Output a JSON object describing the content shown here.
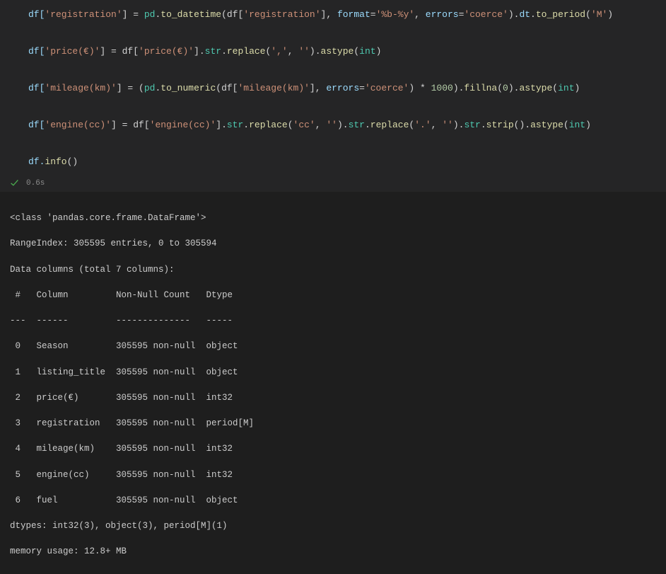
{
  "code": {
    "line1": {
      "a": "df[",
      "s1": "'registration'",
      "b": "] = ",
      "pd": "pd",
      "c": ".",
      "todt": "to_datetime",
      "d": "(df[",
      "s2": "'registration'",
      "e": "], ",
      "fmtk": "format",
      "f": "=",
      "s3": "'%b-%y'",
      "g": ", ",
      "errk": "errors",
      "h": "=",
      "s4": "'coerce'",
      "i": ").",
      "dt": "dt",
      "j": ".",
      "tp": "to_period",
      "k": "(",
      "s5": "'M'",
      "l": ")"
    },
    "line2": {
      "a": "df[",
      "s1": "'price(€)'",
      "b": "] = df[",
      "s2": "'price(€)'",
      "c": "].",
      "strm": "str",
      "d": ".",
      "rep": "replace",
      "e": "(",
      "s3": "','",
      "f": ", ",
      "s4": "''",
      "g": ").",
      "ast": "astype",
      "h": "(",
      "inttype": "int",
      "i": ")"
    },
    "line3": {
      "a": "df[",
      "s1": "'mileage(km)'",
      "b": "] = (",
      "pd": "pd",
      "c": ".",
      "ton": "to_numeric",
      "d": "(df[",
      "s2": "'mileage(km)'",
      "e": "], ",
      "errk": "errors",
      "f": "=",
      "s3": "'coerce'",
      "g": ") * ",
      "thou": "1000",
      "h": ").",
      "fillna": "fillna",
      "i": "(",
      "zero": "0",
      "j": ").",
      "ast": "astype",
      "k": "(",
      "inttype": "int",
      "l": ")"
    },
    "line4": {
      "a": "df[",
      "s1": "'engine(cc)'",
      "b": "] = df[",
      "s2": "'engine(cc)'",
      "c": "].",
      "strm": "str",
      "d": ".",
      "rep": "replace",
      "e": "(",
      "s3": "'cc'",
      "f": ", ",
      "s4": "''",
      "g": ").",
      "strm2": "str",
      "h": ".",
      "rep2": "replace",
      "i": "(",
      "s5": "'.'",
      "j": ", ",
      "s6": "''",
      "k": ").",
      "strm3": "str",
      "l": ".",
      "strip": "strip",
      "m": "().",
      "ast": "astype",
      "n": "(",
      "inttype": "int",
      "o": ")"
    },
    "line5": {
      "a": "df.",
      "info": "info",
      "b": "()"
    }
  },
  "status": {
    "time": "0.6s"
  },
  "output": {
    "l1": "<class 'pandas.core.frame.DataFrame'>",
    "l2": "RangeIndex: 305595 entries, 0 to 305594",
    "l3": "Data columns (total 7 columns):",
    "l4": " #   Column         Non-Null Count   Dtype    ",
    "l5": "---  ------         --------------   -----    ",
    "l6": " 0   Season         305595 non-null  object   ",
    "l7": " 1   listing_title  305595 non-null  object   ",
    "l8": " 2   price(€)       305595 non-null  int32    ",
    "l9": " 3   registration   305595 non-null  period[M]",
    "l10": " 4   mileage(km)    305595 non-null  int32    ",
    "l11": " 5   engine(cc)     305595 non-null  int32    ",
    "l12": " 6   fuel           305595 non-null  object   ",
    "l13": "dtypes: int32(3), object(3), period[M](1)",
    "l14": "memory usage: 12.8+ MB"
  }
}
